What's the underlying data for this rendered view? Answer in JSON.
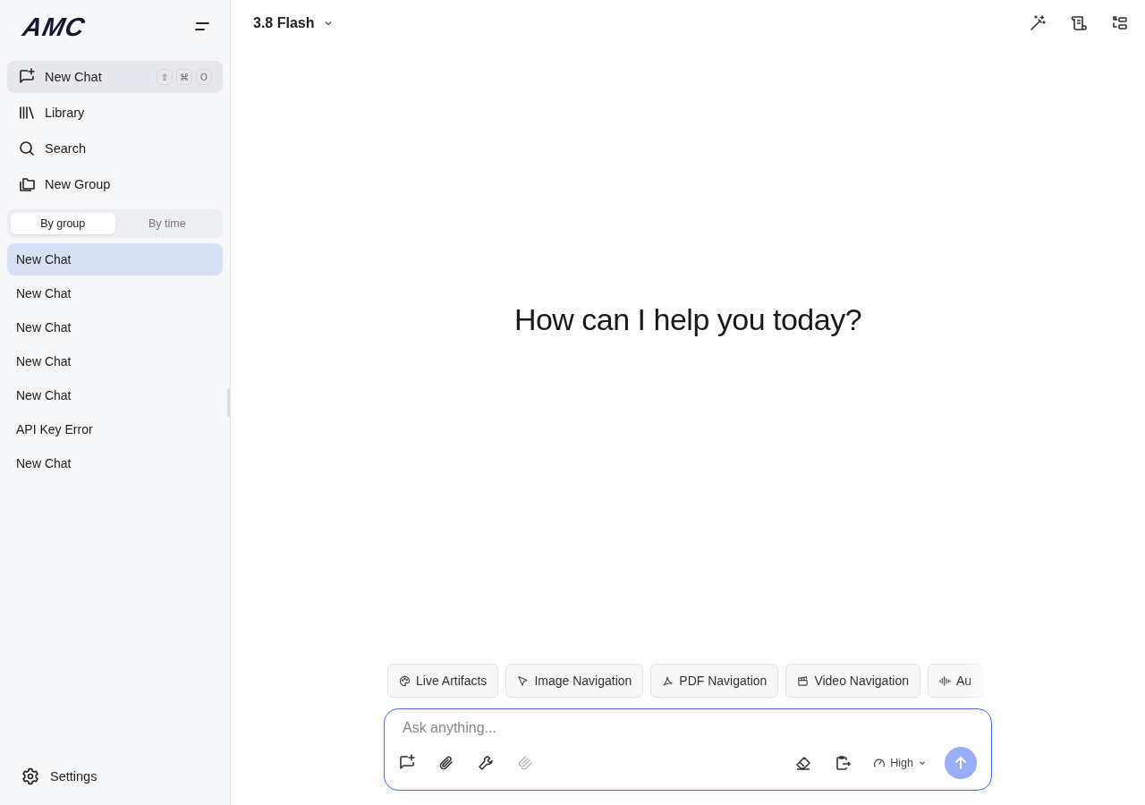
{
  "sidebar": {
    "logo": "AMC",
    "nav": [
      {
        "kind": "new-chat",
        "label": "New Chat",
        "selected": true,
        "keys": [
          "⇧",
          "⌘",
          "O"
        ]
      },
      {
        "kind": "library",
        "label": "Library",
        "selected": false
      },
      {
        "kind": "search",
        "label": "Search",
        "selected": false
      },
      {
        "kind": "group",
        "label": "New Group",
        "selected": false
      }
    ],
    "view_tabs": [
      {
        "label": "By group",
        "selected": true
      },
      {
        "label": "By time",
        "selected": false
      }
    ],
    "chats": [
      {
        "title": "New Chat",
        "selected": true
      },
      {
        "title": "New Chat",
        "selected": false
      },
      {
        "title": "New Chat",
        "selected": false
      },
      {
        "title": "New Chat",
        "selected": false
      },
      {
        "title": "New Chat",
        "selected": false
      },
      {
        "title": "API Key Error",
        "selected": false
      },
      {
        "title": "New Chat",
        "selected": false
      }
    ],
    "settings": "Settings"
  },
  "header": {
    "model": "3.8 Flash"
  },
  "main": {
    "greeting": "How can I help you today?"
  },
  "chips": [
    {
      "kind": "palette",
      "label": "Live Artifacts"
    },
    {
      "kind": "pointer",
      "label": "Image Navigation"
    },
    {
      "kind": "pdf",
      "label": "PDF Navigation"
    },
    {
      "kind": "clapper",
      "label": "Video Navigation"
    },
    {
      "kind": "wave",
      "label": "Au"
    }
  ],
  "composer": {
    "placeholder": "Ask anything...",
    "tools": [
      {
        "kind": "new-chat",
        "disabled": false
      },
      {
        "kind": "clip",
        "disabled": false
      },
      {
        "kind": "wrench",
        "disabled": false
      },
      {
        "kind": "multi-clip",
        "disabled": true
      }
    ],
    "effort": "High"
  }
}
